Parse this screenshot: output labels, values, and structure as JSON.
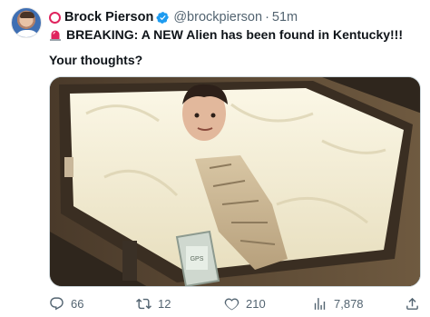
{
  "tweet": {
    "author_name": "Brock Pierson",
    "handle": "@brockpierson",
    "separator": "·",
    "time": "51m",
    "line1": "BREAKING: A NEW Alien has been found in Kentucky!!!",
    "line2": "Your thoughts?",
    "icons": {
      "before_name": "red-circle-emoji",
      "verified": "verified-badge-icon",
      "before_text": "siren-emoji"
    },
    "colors": {
      "verified": "#1d9bf0",
      "circle": "#e0245e",
      "siren": "#e0245e",
      "muted": "#536471"
    }
  },
  "image": {
    "label": "GPS"
  },
  "actions": {
    "replies": "66",
    "retweets": "12",
    "likes": "210",
    "views": "7,878"
  }
}
